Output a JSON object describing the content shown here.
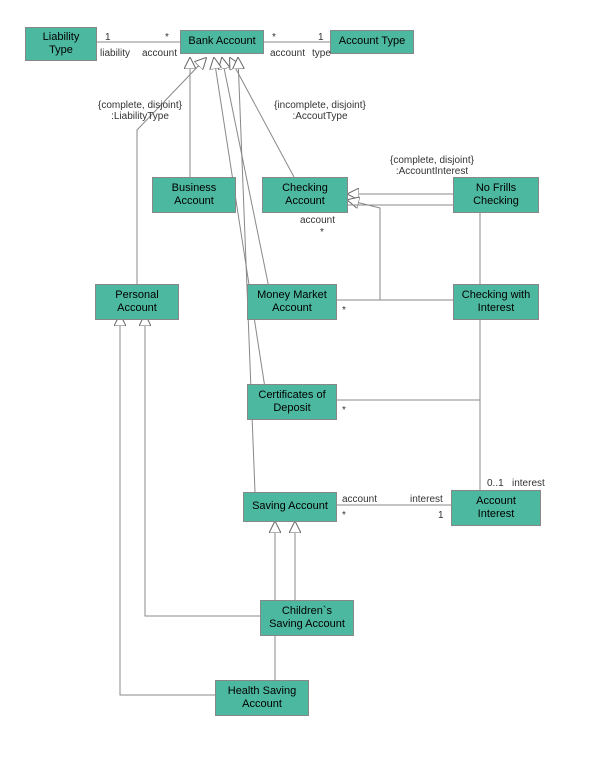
{
  "boxes": {
    "liabilityType": "Liability\nType",
    "bankAccount": "Bank Account",
    "accountType": "Account Type",
    "businessAccount": "Business\nAccount",
    "checkingAccount": "Checking\nAccount",
    "noFrillsChecking": "No Frills\nChecking",
    "personalAccount": "Personal\nAccount",
    "moneyMarketAccount": "Money Market\nAccount",
    "checkingWithInterest": "Checking with\nInterest",
    "certificatesOfDeposit": "Certificates of\nDeposit",
    "savingAccount": "Saving Account",
    "accountInterest": "Account\nInterest",
    "childrensSavingAccount": "Children`s\nSaving Account",
    "healthSavingAccount": "Health Saving\nAccount"
  },
  "labels": {
    "one1": "1",
    "star1": "*",
    "liability": "liability",
    "account1": "account",
    "star2": "*",
    "one2": "1",
    "account2": "account",
    "type": "type",
    "constraint1": "{complete, disjoint}\n:LiabilityType",
    "constraint2": "{incomplete, disjoint}\n:AccoutType",
    "constraint3": "{complete, disjoint}\n:AccountInterest",
    "account3": "account",
    "star3": "*",
    "star4": "*",
    "star5": "*",
    "account4": "account",
    "star6": "*",
    "interest1": "interest",
    "one3": "1",
    "zeroOne": "0..1",
    "interest2": "interest"
  }
}
